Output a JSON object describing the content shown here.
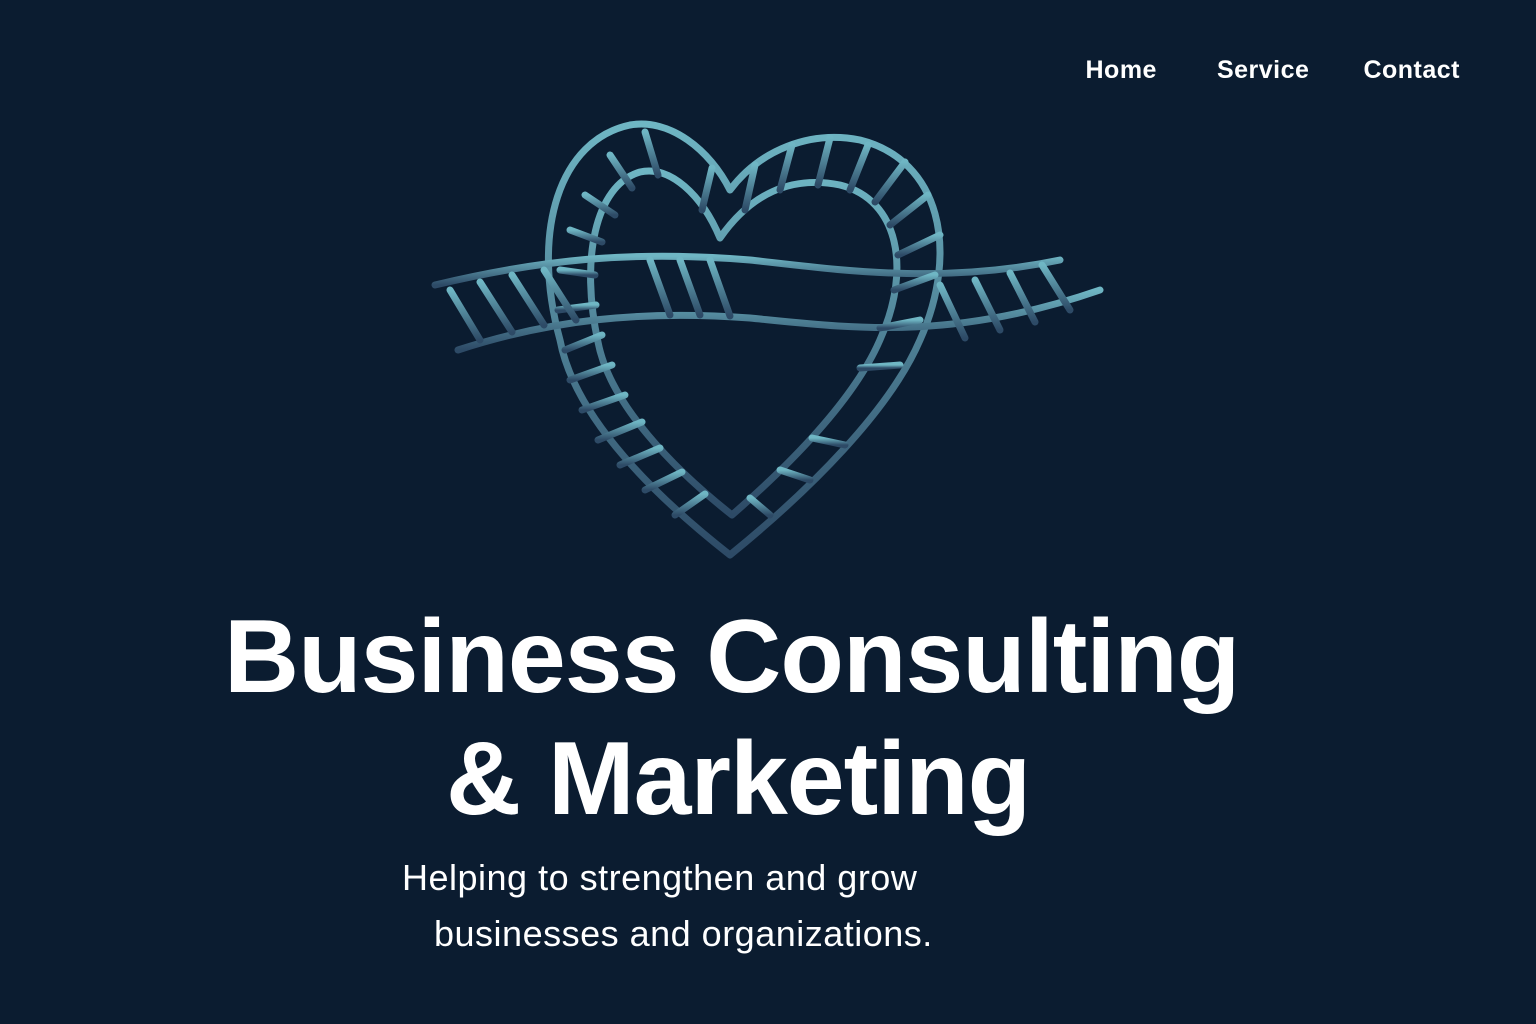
{
  "nav": {
    "items": [
      {
        "label": "Home"
      },
      {
        "label": "Service"
      },
      {
        "label": "Contact"
      }
    ]
  },
  "hero": {
    "title_line1": "Business Consulting",
    "title_line2": "& Marketing",
    "subtitle_line1": "Helping to strengthen and grow",
    "subtitle_line2": "businesses and organizations."
  },
  "logo": {
    "icon": "rope-heart-knot-icon",
    "gradient_top": "#6fb6c4",
    "gradient_bottom": "#2d4a66"
  },
  "colors": {
    "background": "#0b1c30",
    "text": "#ffffff"
  }
}
